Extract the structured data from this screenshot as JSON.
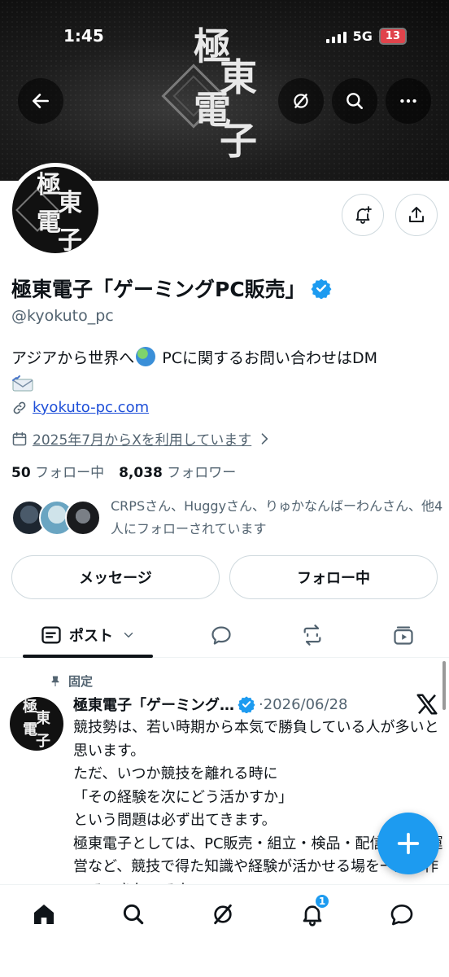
{
  "status_bar": {
    "time": "1:45",
    "network": "5G",
    "battery": "13"
  },
  "banner": {
    "logo_chars": [
      "極",
      "東",
      "電",
      "子"
    ]
  },
  "profile": {
    "avatar_chars": [
      "極",
      "東",
      "電",
      "子"
    ],
    "name": "極東電子「ゲーミングPC販売」",
    "handle": "@kyokuto_pc",
    "bio_before": "アジアから世界へ",
    "bio_after": " PCに関するお問い合わせはDM",
    "link": "kyokuto-pc.com",
    "joined": "2025年7月からXを利用しています",
    "following_count": "50",
    "following_label": "フォロー中",
    "followers_count": "8,038",
    "followers_label": "フォロワー",
    "followed_by_text": "CRPSさん、Huggyさん、りゅかなんばーわんさん、他4人にフォローされています",
    "message_button": "メッセージ",
    "following_button": "フォロー中"
  },
  "tabs": {
    "posts_label": "ポスト"
  },
  "post": {
    "pinned_label": "固定",
    "author": "極東電子「ゲーミング…",
    "date": "·2026/06/28",
    "body": "競技勢は、若い時期から本気で勝負している人が多いと思います。\nただ、いつか競技を離れる時に\n「その経験を次にどう活かすか」\nという問題は必ず出てきます。\n極東電子としては、PC販売・組立・検品・配信・大会運営など、競技で得た知識や経験が活かせる場を一緒に作っていきたいです。"
  },
  "bottom_nav": {
    "notification_badge": "1"
  },
  "colors": {
    "accent": "#1d9bf0",
    "text": "#0f1419",
    "secondary": "#536471"
  }
}
